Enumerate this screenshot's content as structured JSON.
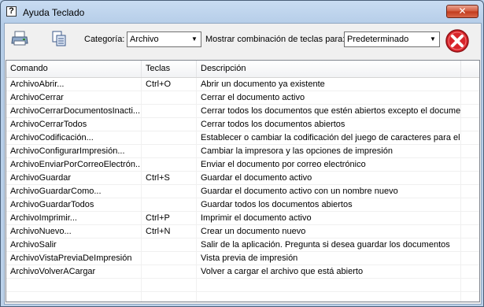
{
  "window": {
    "title": "Ayuda Teclado",
    "close_glyph": "✕",
    "help_glyph": "?"
  },
  "toolbar": {
    "print_icon": "printer-icon",
    "copy_icon": "copy-icon",
    "category_label": "Categoría:",
    "category_value": "Archivo",
    "show_combo_label": "Mostrar combinación de teclas para:",
    "show_combo_value": "Predeterminado",
    "close_icon": "red-x-close-icon",
    "accent_red": "#d8242a"
  },
  "table": {
    "columns": [
      "Comando",
      "Teclas",
      "Descripción"
    ],
    "rows": [
      {
        "command": "ArchivoAbrir...",
        "keys": "Ctrl+O",
        "description": "Abrir un documento ya existente"
      },
      {
        "command": "ArchivoCerrar",
        "keys": "",
        "description": "Cerrar el documento activo"
      },
      {
        "command": "ArchivoCerrarDocumentosInacti...",
        "keys": "",
        "description": "Cerrar todos los documentos que estén abiertos excepto el docume..."
      },
      {
        "command": "ArchivoCerrarTodos",
        "keys": "",
        "description": "Cerrar todos los documentos abiertos"
      },
      {
        "command": "ArchivoCodificación...",
        "keys": "",
        "description": "Establecer o cambiar la codificación del juego de caracteres para el..."
      },
      {
        "command": "ArchivoConfigurarImpresión...",
        "keys": "",
        "description": "Cambiar la impresora y las opciones de impresión"
      },
      {
        "command": "ArchivoEnviarPorCorreoElectrón...",
        "keys": "",
        "description": "Enviar el documento por correo electrónico"
      },
      {
        "command": "ArchivoGuardar",
        "keys": "Ctrl+S",
        "description": "Guardar el documento activo"
      },
      {
        "command": "ArchivoGuardarComo...",
        "keys": "",
        "description": "Guardar el documento activo con un nombre nuevo"
      },
      {
        "command": "ArchivoGuardarTodos",
        "keys": "",
        "description": "Guardar todos los documentos abiertos"
      },
      {
        "command": "ArchivoImprimir...",
        "keys": "Ctrl+P",
        "description": "Imprimir el documento activo"
      },
      {
        "command": "ArchivoNuevo...",
        "keys": "Ctrl+N",
        "description": "Crear un documento nuevo"
      },
      {
        "command": "ArchivoSalir",
        "keys": "",
        "description": "Salir de la aplicación. Pregunta si desea guardar los documentos"
      },
      {
        "command": "ArchivoVistaPreviaDeImpresión",
        "keys": "",
        "description": "Vista previa de impresión"
      },
      {
        "command": "ArchivoVolverACargar",
        "keys": "",
        "description": "Volver a cargar el archivo que está abierto"
      }
    ]
  }
}
